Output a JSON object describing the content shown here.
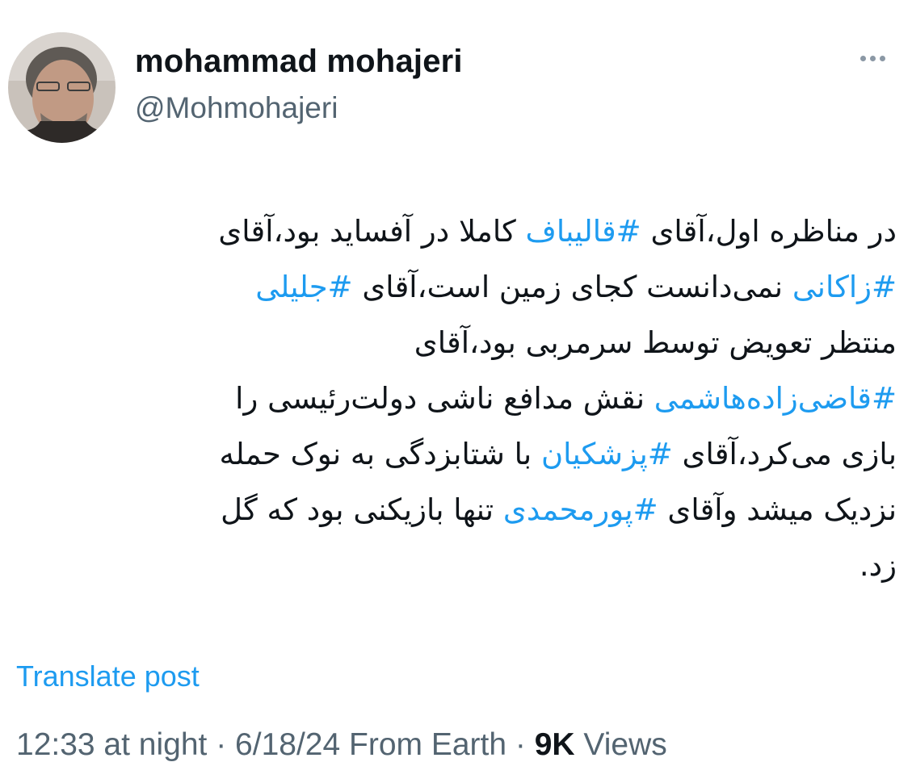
{
  "author": {
    "display_name": "mohammad mohajeri",
    "handle": "@Mohmohajeri"
  },
  "tweet": {
    "lines": [
      [
        {
          "t": "در مناظره اول،آقای "
        },
        {
          "t": "#قالیباف",
          "h": true
        },
        {
          "t": " کاملا در آفساید بود،آقای"
        }
      ],
      [
        {
          "t": "#زاکانی",
          "h": true
        },
        {
          "t": "  نمی‌دانست کجای زمین است،آقای "
        },
        {
          "t": "#جلیلی",
          "h": true
        }
      ],
      [
        {
          "t": "منتظر تعویض توسط سرمربی بود،آقای"
        }
      ],
      [
        {
          "t": "#قاضی‌زاده‌هاشمی",
          "h": true
        },
        {
          "t": " نقش مدافع ناشی دولت‌رئیسی را"
        }
      ],
      [
        {
          "t": "بازی می‌کرد،آقای "
        },
        {
          "t": "#پزشکیان",
          "h": true
        },
        {
          "t": " با شتابزدگی به نوک حمله"
        }
      ],
      [
        {
          "t": "نزدیک میشد وآقای "
        },
        {
          "t": "#پورمحمدی",
          "h": true
        },
        {
          "t": " تنها بازیکنی بود که گل"
        }
      ],
      [
        {
          "t": "زد."
        }
      ]
    ]
  },
  "translate_label": "Translate post",
  "meta": {
    "time": "12:33 at night",
    "sep1": " · ",
    "date": "6/18/24",
    "source": " From Earth",
    "sep2": " · ",
    "views_count": "9K",
    "views_label": " Views"
  },
  "icons": {
    "more": "more-horizontal-icon"
  },
  "colors": {
    "link": "#1d9bf0",
    "secondary_text": "#536471",
    "primary_text": "#0f1419"
  }
}
